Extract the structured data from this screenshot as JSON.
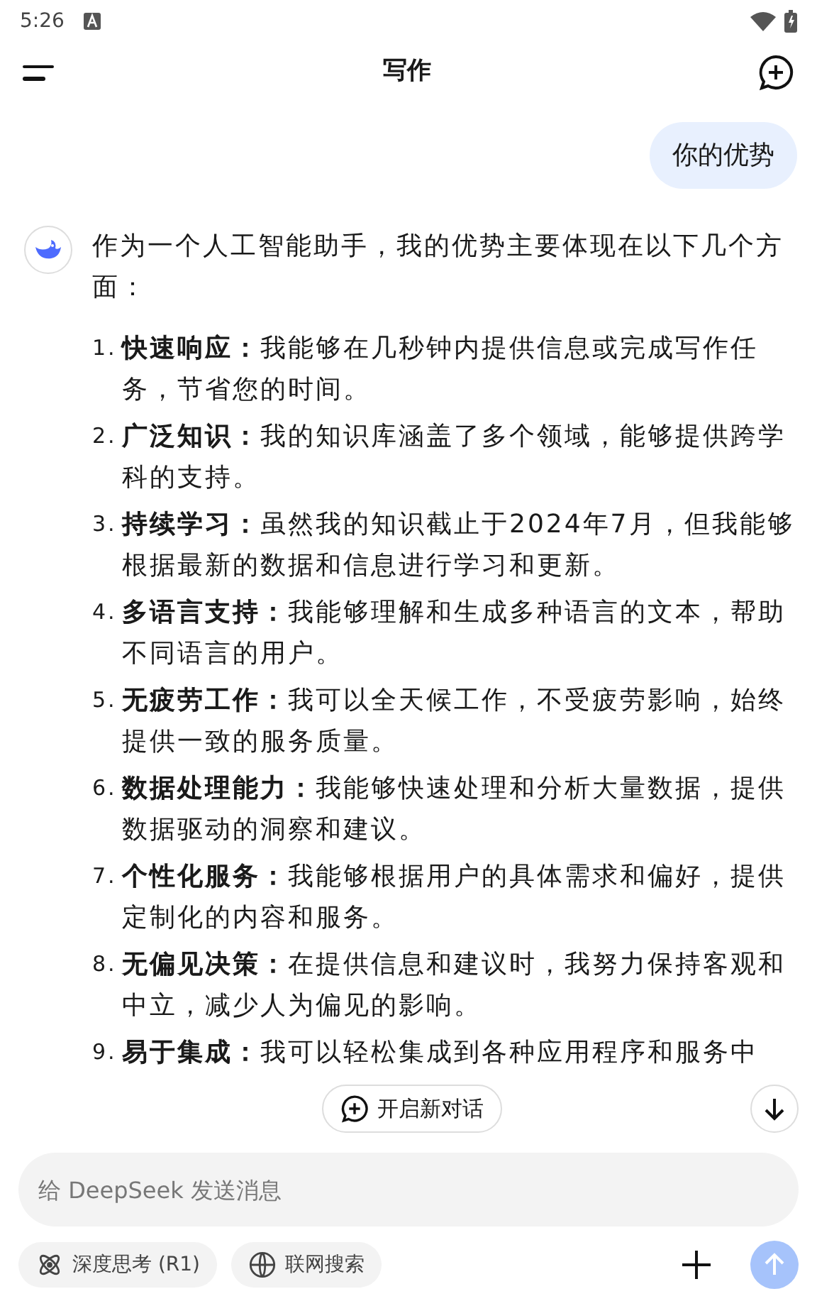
{
  "status_bar": {
    "time": "5:26"
  },
  "header": {
    "title": "写作"
  },
  "user_message": {
    "text": "你的优势"
  },
  "assistant_message": {
    "intro": "作为一个人工智能助手，我的优势主要体现在以下几个方面：",
    "items": [
      {
        "number": "1.",
        "title": "快速响应：",
        "text": "我能够在几秒钟内提供信息或完成写作任务，节省您的时间。"
      },
      {
        "number": "2.",
        "title": "广泛知识：",
        "text": "我的知识库涵盖了多个领域，能够提供跨学科的支持。"
      },
      {
        "number": "3.",
        "title": "持续学习：",
        "text": "虽然我的知识截止于2024年7月，但我能够根据最新的数据和信息进行学习和更新。"
      },
      {
        "number": "4.",
        "title": "多语言支持：",
        "text": "我能够理解和生成多种语言的文本，帮助不同语言的用户。"
      },
      {
        "number": "5.",
        "title": "无疲劳工作：",
        "text": "我可以全天候工作，不受疲劳影响，始终提供一致的服务质量。"
      },
      {
        "number": "6.",
        "title": "数据处理能力：",
        "text": "我能够快速处理和分析大量数据，提供数据驱动的洞察和建议。"
      },
      {
        "number": "7.",
        "title": "个性化服务：",
        "text": "我能够根据用户的具体需求和偏好，提供定制化的内容和服务。"
      },
      {
        "number": "8.",
        "title": "无偏见决策：",
        "text": "在提供信息和建议时，我努力保持客观和中立，减少人为偏见的影响。"
      },
      {
        "number": "9.",
        "title": "易于集成：",
        "text": "我可以轻松集成到各种应用程序和服务中"
      }
    ]
  },
  "new_chat_button": {
    "label": "开启新对话"
  },
  "composer": {
    "placeholder": "给 DeepSeek 发送消息",
    "options": [
      {
        "label": "深度思考 (R1)",
        "kind": "think",
        "selected": false
      },
      {
        "label": "联网搜索",
        "kind": "web",
        "selected": false
      }
    ],
    "send_disabled": true
  }
}
